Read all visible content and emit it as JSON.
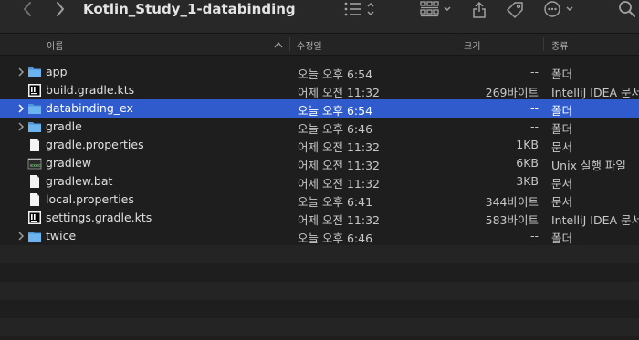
{
  "window": {
    "title": "Kotlin_Study_1-databinding"
  },
  "columns": {
    "name": "이름",
    "date": "수정일",
    "size": "크기",
    "kind": "종류"
  },
  "files": [
    {
      "name": "app",
      "date": "오늘 오후 6:54",
      "size": "--",
      "kind": "폴더",
      "icon": "folder-icon",
      "expandable": true,
      "selected": false
    },
    {
      "name": "build.gradle.kts",
      "date": "어제 오전 11:32",
      "size": "269바이트",
      "kind": "IntelliJ IDEA 문서",
      "icon": "intellij-file-icon",
      "expandable": false,
      "selected": false
    },
    {
      "name": "databinding_ex",
      "date": "오늘 오후 6:54",
      "size": "--",
      "kind": "폴더",
      "icon": "folder-icon",
      "expandable": true,
      "selected": true
    },
    {
      "name": "gradle",
      "date": "오늘 오후 6:46",
      "size": "--",
      "kind": "폴더",
      "icon": "folder-icon",
      "expandable": true,
      "selected": false
    },
    {
      "name": "gradle.properties",
      "date": "어제 오전 11:32",
      "size": "1KB",
      "kind": "문서",
      "icon": "document-icon",
      "expandable": false,
      "selected": false
    },
    {
      "name": "gradlew",
      "date": "어제 오전 11:32",
      "size": "6KB",
      "kind": "Unix 실행 파일",
      "icon": "terminal-file-icon",
      "expandable": false,
      "selected": false
    },
    {
      "name": "gradlew.bat",
      "date": "어제 오전 11:32",
      "size": "3KB",
      "kind": "문서",
      "icon": "document-icon",
      "expandable": false,
      "selected": false
    },
    {
      "name": "local.properties",
      "date": "오늘 오후 6:41",
      "size": "344바이트",
      "kind": "문서",
      "icon": "document-icon",
      "expandable": false,
      "selected": false
    },
    {
      "name": "settings.gradle.kts",
      "date": "어제 오전 11:32",
      "size": "583바이트",
      "kind": "IntelliJ IDEA 문서",
      "icon": "intellij-file-icon",
      "expandable": false,
      "selected": false
    },
    {
      "name": "twice",
      "date": "오늘 오후 6:46",
      "size": "--",
      "kind": "폴더",
      "icon": "folder-icon",
      "expandable": true,
      "selected": false
    }
  ],
  "colors": {
    "selection": "#2f5bcc",
    "folder": "#5aa6e8",
    "background": "#1e1e1e"
  }
}
